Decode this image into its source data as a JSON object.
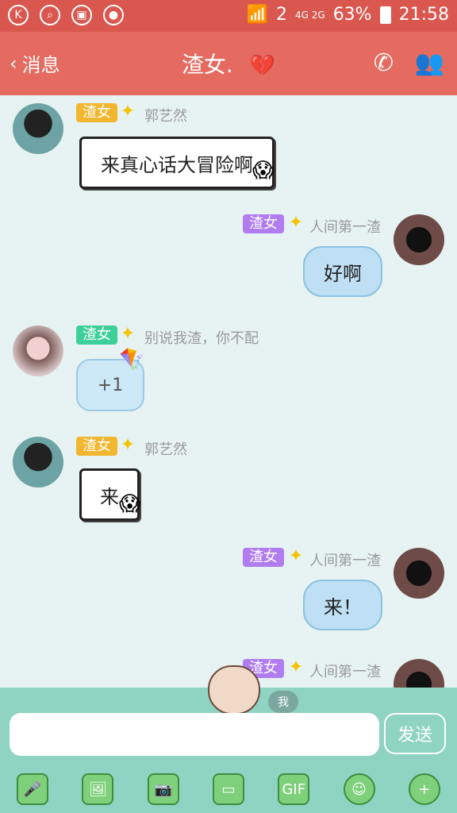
{
  "status": {
    "left_icons": [
      "k-icon",
      "search-icon",
      "image-icon",
      "wechat-icon"
    ],
    "sim": "2",
    "network": "4G 2G",
    "battery": "63%",
    "time": "21:58"
  },
  "titlebar": {
    "back_label": "消息",
    "title": "渣女.",
    "heart_icon": "broken-heart-icon",
    "phone_icon": "phone-icon",
    "people_icon": "people-icon"
  },
  "messages": [
    {
      "tag": "渣女",
      "name": "郭艺然",
      "text": "来真心话大冒险啊"
    },
    {
      "tag": "渣女",
      "name": "人间第一渣",
      "text": "好啊"
    },
    {
      "tag": "渣女",
      "name": "别说我渣，你不配",
      "text": "+1"
    },
    {
      "tag": "渣女",
      "name": "郭艺然",
      "text": "来"
    },
    {
      "tag": "渣女",
      "name": "人间第一渣",
      "text": "来！"
    },
    {
      "tag": "渣女",
      "name": "人间第一渣"
    }
  ],
  "input": {
    "placeholder": "",
    "send_label": "发送",
    "me_label": "我"
  },
  "toolbar": {
    "gif_label": "GIF"
  }
}
